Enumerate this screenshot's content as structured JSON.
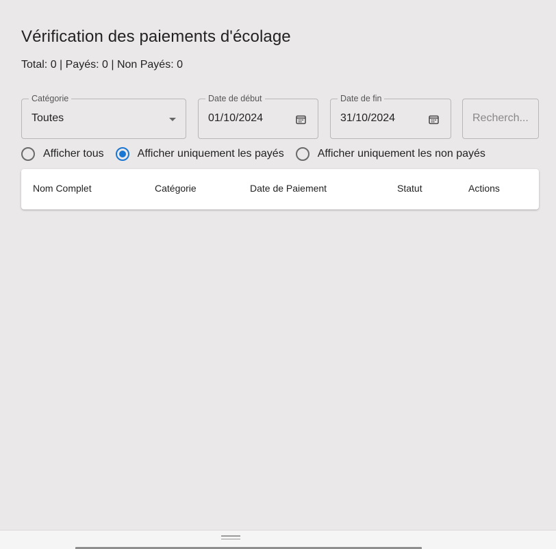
{
  "page": {
    "title": "Vérification des paiements d'écolage",
    "summary": "Total: 0 | Payés: 0 | Non Payés: 0"
  },
  "filters": {
    "category": {
      "label": "Catégorie",
      "value": "Toutes"
    },
    "start_date": {
      "label": "Date de début",
      "value": "01/10/2024"
    },
    "end_date": {
      "label": "Date de fin",
      "value": "31/10/2024"
    },
    "search": {
      "placeholder": "Recherch..."
    }
  },
  "radio_options": [
    {
      "label": "Afficher tous",
      "checked": false
    },
    {
      "label": "Afficher uniquement les payés",
      "checked": true
    },
    {
      "label": "Afficher uniquement les non payés",
      "checked": false
    }
  ],
  "table": {
    "columns": [
      "Nom Complet",
      "Catégorie",
      "Date de Paiement",
      "Statut",
      "Actions"
    ],
    "rows": []
  },
  "colors": {
    "accent": "#1976d2",
    "background": "#ebe8e9"
  },
  "icons": {
    "category_dropdown": "chevron-down-icon",
    "start_date": "calendar-icon",
    "end_date": "calendar-icon",
    "resize": "drag-handle-icon"
  }
}
